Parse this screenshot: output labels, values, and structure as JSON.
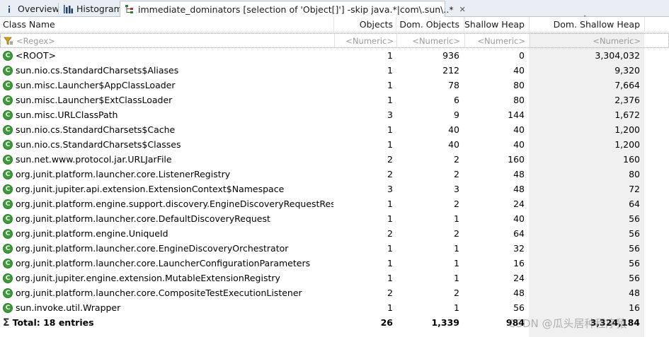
{
  "tabs": [
    {
      "label": "Overview",
      "icon": "info-icon"
    },
    {
      "label": "Histogram",
      "icon": "histogram-icon"
    },
    {
      "label": "immediate_dominators  [selection of 'Object[]'] -skip java.*|com\\.sun\\..*",
      "icon": "dominator-tree-icon",
      "close": "✕"
    }
  ],
  "columns": {
    "class_name": "Class Name",
    "objects": "Objects",
    "dom_objects": "Dom. Objects",
    "shallow_heap": "Shallow Heap",
    "dom_shallow_heap": "Dom. Shallow Heap"
  },
  "filters": {
    "class_name": "<Regex>",
    "objects": "<Numeric>",
    "dom_objects": "<Numeric>",
    "shallow_heap": "<Numeric>",
    "dom_shallow_heap": "<Numeric>"
  },
  "rows": [
    {
      "name": "<ROOT>",
      "objects": "1",
      "dom_objects": "936",
      "shallow": "0",
      "dom_shallow": "3,304,032"
    },
    {
      "name": "sun.nio.cs.StandardCharsets$Aliases",
      "objects": "1",
      "dom_objects": "212",
      "shallow": "40",
      "dom_shallow": "9,320"
    },
    {
      "name": "sun.misc.Launcher$AppClassLoader",
      "objects": "1",
      "dom_objects": "78",
      "shallow": "80",
      "dom_shallow": "7,664"
    },
    {
      "name": "sun.misc.Launcher$ExtClassLoader",
      "objects": "1",
      "dom_objects": "6",
      "shallow": "80",
      "dom_shallow": "2,376"
    },
    {
      "name": "sun.misc.URLClassPath",
      "objects": "3",
      "dom_objects": "9",
      "shallow": "144",
      "dom_shallow": "1,672"
    },
    {
      "name": "sun.nio.cs.StandardCharsets$Cache",
      "objects": "1",
      "dom_objects": "40",
      "shallow": "40",
      "dom_shallow": "1,200"
    },
    {
      "name": "sun.nio.cs.StandardCharsets$Classes",
      "objects": "1",
      "dom_objects": "40",
      "shallow": "40",
      "dom_shallow": "1,200"
    },
    {
      "name": "sun.net.www.protocol.jar.URLJarFile",
      "objects": "2",
      "dom_objects": "2",
      "shallow": "160",
      "dom_shallow": "160"
    },
    {
      "name": "org.junit.platform.launcher.core.ListenerRegistry",
      "objects": "2",
      "dom_objects": "2",
      "shallow": "48",
      "dom_shallow": "80"
    },
    {
      "name": "org.junit.jupiter.api.extension.ExtensionContext$Namespace",
      "objects": "3",
      "dom_objects": "3",
      "shallow": "48",
      "dom_shallow": "72"
    },
    {
      "name": "org.junit.platform.engine.support.discovery.EngineDiscoveryRequestResolver",
      "objects": "1",
      "dom_objects": "2",
      "shallow": "24",
      "dom_shallow": "64"
    },
    {
      "name": "org.junit.platform.launcher.core.DefaultDiscoveryRequest",
      "objects": "1",
      "dom_objects": "1",
      "shallow": "40",
      "dom_shallow": "56"
    },
    {
      "name": "org.junit.platform.engine.UniqueId",
      "objects": "2",
      "dom_objects": "2",
      "shallow": "64",
      "dom_shallow": "56"
    },
    {
      "name": "org.junit.platform.launcher.core.EngineDiscoveryOrchestrator",
      "objects": "1",
      "dom_objects": "1",
      "shallow": "32",
      "dom_shallow": "56"
    },
    {
      "name": "org.junit.platform.launcher.core.LauncherConfigurationParameters",
      "objects": "1",
      "dom_objects": "1",
      "shallow": "16",
      "dom_shallow": "56"
    },
    {
      "name": "org.junit.jupiter.engine.extension.MutableExtensionRegistry",
      "objects": "1",
      "dom_objects": "1",
      "shallow": "24",
      "dom_shallow": "56"
    },
    {
      "name": "org.junit.platform.launcher.core.CompositeTestExecutionListener",
      "objects": "2",
      "dom_objects": "2",
      "shallow": "48",
      "dom_shallow": "48"
    },
    {
      "name": "sun.invoke.util.Wrapper",
      "objects": "1",
      "dom_objects": "1",
      "shallow": "56",
      "dom_shallow": "16"
    }
  ],
  "total": {
    "label": "Total: 18 entries",
    "objects": "26",
    "dom_objects": "1,339",
    "shallow": "984",
    "dom_shallow": "3,324,184"
  },
  "watermark": "CSDN @瓜头居种程序猿",
  "colors": {
    "class_icon": "#3e9b3a",
    "tab_bar": "#e9eef5",
    "sorted_column_bg": "#f0f0f0"
  }
}
